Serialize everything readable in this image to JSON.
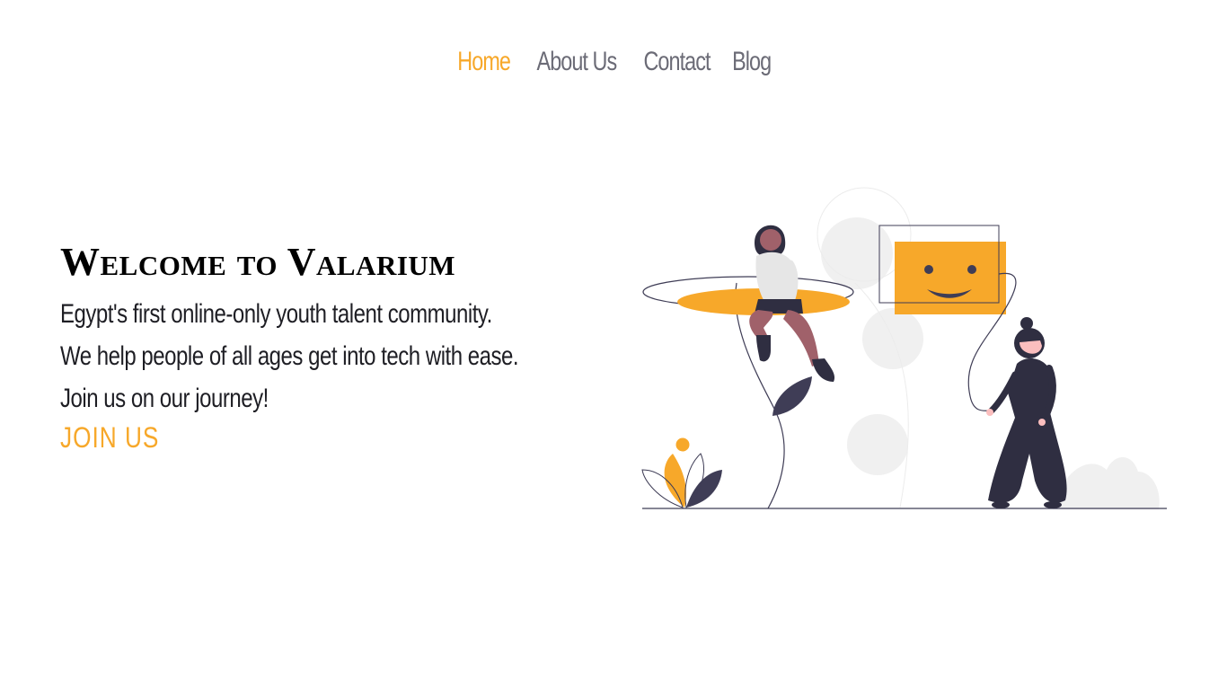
{
  "nav": {
    "items": [
      {
        "label": "Home",
        "active": true
      },
      {
        "label": "About Us",
        "active": false
      },
      {
        "label": "Contact",
        "active": false
      },
      {
        "label": "Blog",
        "active": false
      }
    ]
  },
  "hero": {
    "title": "Welcome to Valarium",
    "lines": [
      "Egypt's first online-only youth talent community.",
      "We help people of all ages get into tech with ease.",
      "Join us on our journey!"
    ],
    "cta": "JOIN US"
  },
  "illustration": {
    "description_icon": "people-chat-illustration"
  },
  "colors": {
    "accent": "#f7a82a",
    "nav_text": "#6b6b76",
    "dark": "#2f2e41"
  }
}
